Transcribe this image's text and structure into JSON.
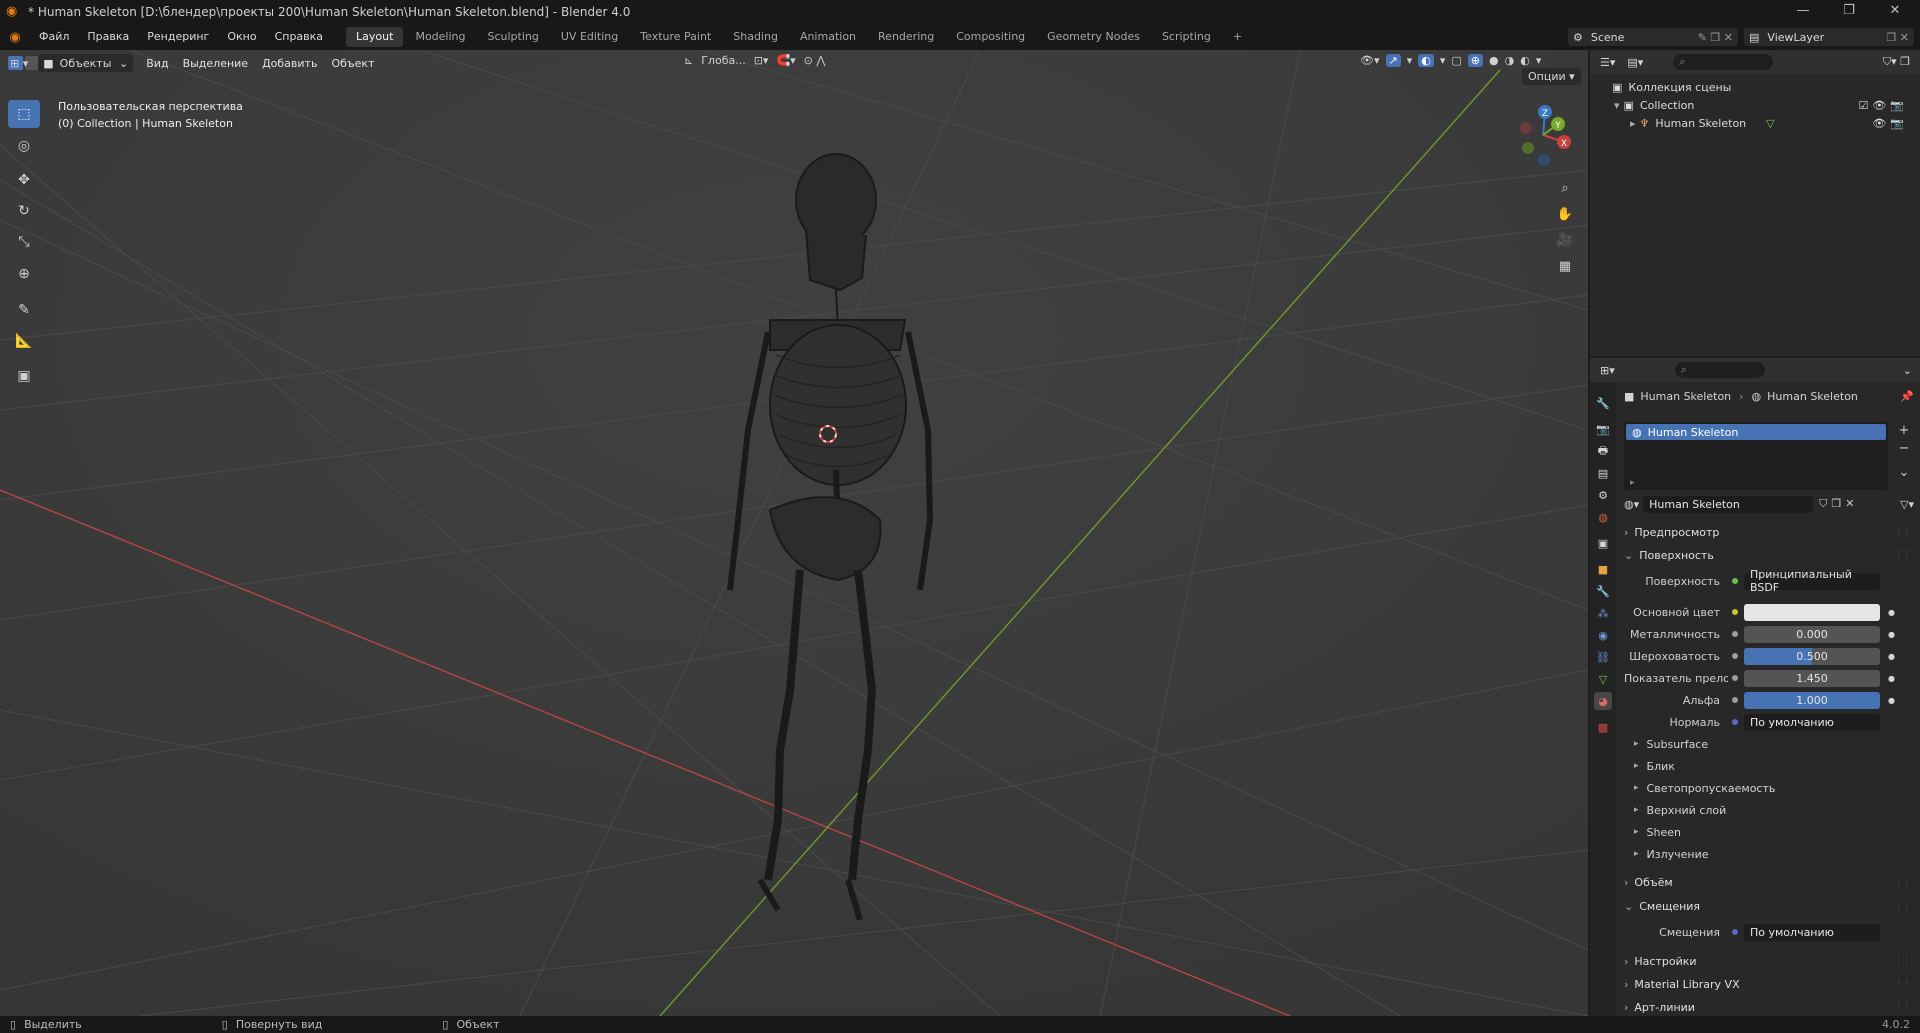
{
  "window": {
    "title": "* Human Skeleton [D:\\блендер\\проекты 200\\Human Skeleton\\Human Skeleton.blend] - Blender 4.0"
  },
  "menu": [
    "Файл",
    "Правка",
    "Рендеринг",
    "Окно",
    "Справка"
  ],
  "workspaces": [
    "Layout",
    "Modeling",
    "Sculpting",
    "UV Editing",
    "Texture Paint",
    "Shading",
    "Animation",
    "Rendering",
    "Compositing",
    "Geometry Nodes",
    "Scripting"
  ],
  "workspace_add": "+",
  "scene": {
    "name": "Scene",
    "viewlayer": "ViewLayer"
  },
  "viewport": {
    "mode": "Объекты",
    "menus": [
      "Вид",
      "Выделение",
      "Добавить",
      "Объект"
    ],
    "transform_orientation": "Глоба...",
    "options_label": "Опции",
    "info_line1": "Пользовательская перспектива",
    "info_line2": "(0) Collection | Human Skeleton",
    "gizmo_labels": {
      "z": "Z",
      "y": "Y",
      "x": "X"
    }
  },
  "outliner": {
    "scene_collection": "Коллекция сцены",
    "collection": "Collection",
    "object": "Human Skeleton"
  },
  "properties": {
    "breadcrumb_object": "Human Skeleton",
    "breadcrumb_material": "Human Skeleton",
    "slot_name": "Human Skeleton",
    "material_name": "Human Skeleton",
    "sections": {
      "preview": "Предпросмотр",
      "surface": "Поверхность",
      "volume": "Объём",
      "displacement": "Смещения",
      "settings": "Настройки",
      "matlib": "Material Library VX",
      "lineart": "Арт-линии"
    },
    "fields": {
      "surface_label": "Поверхность",
      "surface_value": "Принципиальный BSDF",
      "base_color_label": "Основной цвет",
      "base_color": "#e6e6e6",
      "metallic_label": "Металличность",
      "metallic": "0.000",
      "roughness_label": "Шероховатость",
      "roughness": "0.500",
      "roughness_fraction": 0.5,
      "ior_label": "Показатель прело...",
      "ior": "1.450",
      "alpha_label": "Альфа",
      "alpha": "1.000",
      "alpha_fraction": 1.0,
      "normal_label": "Нормаль",
      "normal_value": "По умолчанию",
      "disp_label": "Смещения",
      "disp_value": "По умолчанию"
    },
    "subpanels": [
      "Subsurface",
      "Блик",
      "Светопропускаемость",
      "Верхний слой",
      "Sheen",
      "Излучение"
    ]
  },
  "status": {
    "select": "Выделить",
    "rotate": "Повернуть вид",
    "object": "Объект",
    "version": "4.0.2"
  },
  "colors": {
    "accent": "#4772b3",
    "x_axis": "#c8413f",
    "y_axis": "#7aa82d",
    "z_axis": "#3b78c2"
  }
}
